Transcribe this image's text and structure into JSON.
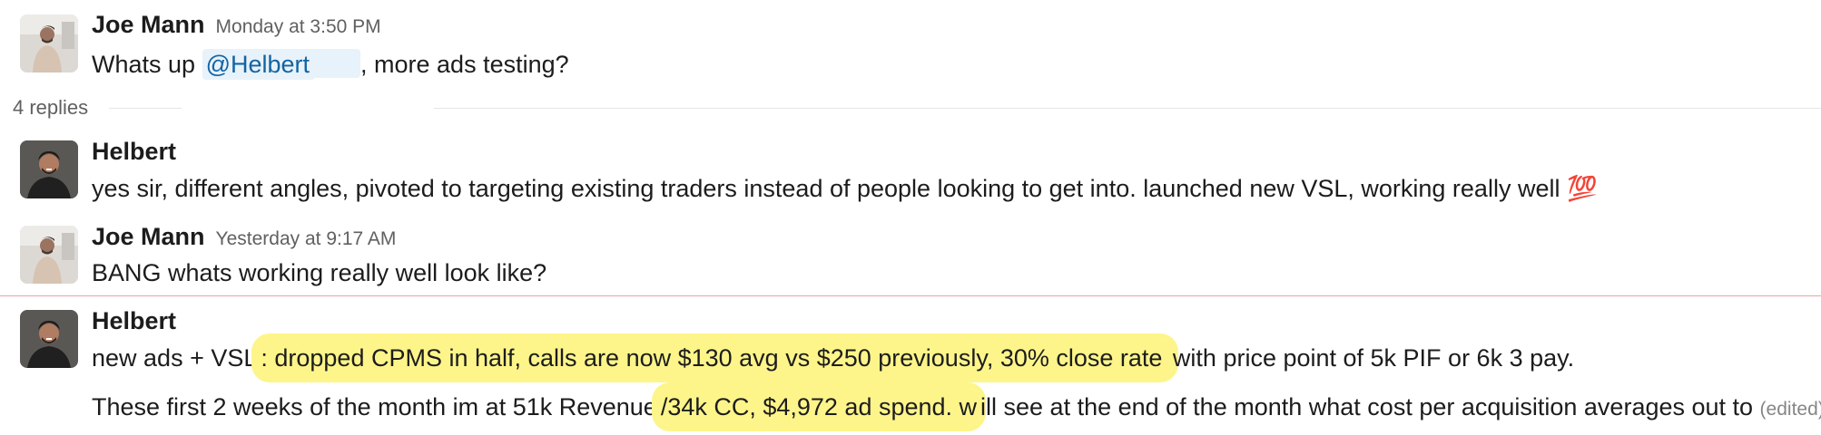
{
  "messages": [
    {
      "sender": "Joe Mann",
      "time": "Monday at 3:50 PM",
      "text_before": "Whats up ",
      "mention": "@Helbert",
      "text_after": ", more ads testing?"
    },
    {
      "sender": "Helbert",
      "text": "yes sir, different angles, pivoted to targeting existing traders instead of people looking to get into. launched new VSL, working really well ",
      "emoji": "💯"
    },
    {
      "sender": "Joe Mann",
      "time": "Yesterday at 9:17 AM",
      "text": "BANG whats working really well look like?"
    },
    {
      "sender": "Helbert",
      "line1_prefix": "new ads + VSL",
      "line1_highlight": ": dropped CPMS in half, calls are now $130 avg vs $250 previously, 30% close rate ",
      "line1_suffix": "with price point of 5k PIF or 6k 3 pay.",
      "line2_prefix": "These first 2 weeks of the month im at 51k Revenue",
      "line2_highlight": "/34k CC, $4,972 ad spend. w",
      "line2_suffix": "ill see at the end of the month what cost per acquisition averages out to ",
      "edited": "(edited)"
    }
  ],
  "thread": {
    "replies_label": "4 replies"
  },
  "colors": {
    "mention": "#1264a3",
    "highlight": "#fdf58a",
    "new_divider": "#e8a3ad"
  },
  "icons": {
    "emoji_100": "hundred-points-emoji"
  }
}
